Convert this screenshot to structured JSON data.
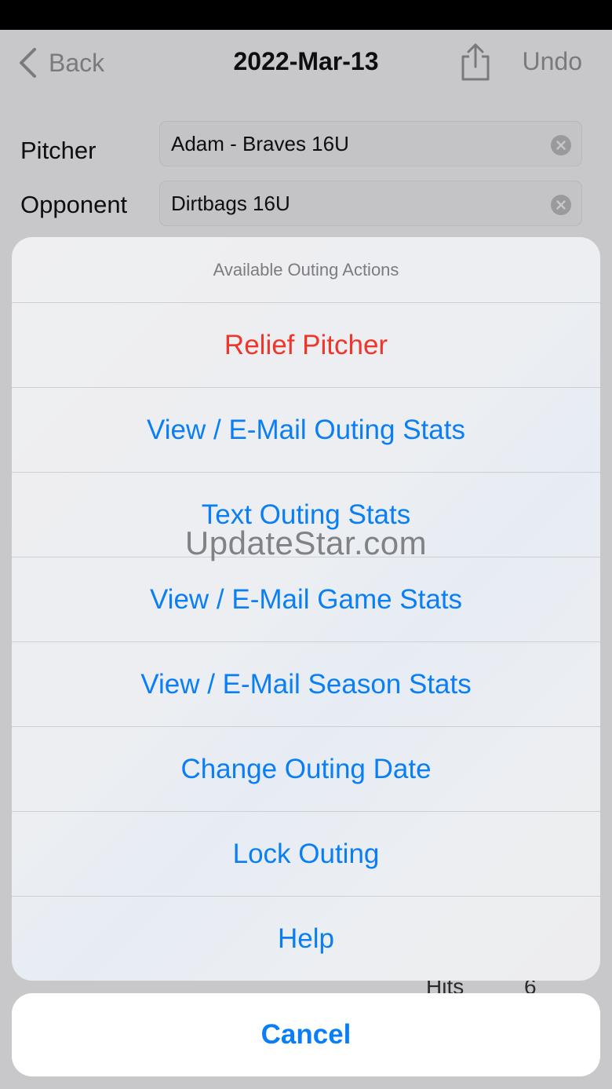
{
  "nav": {
    "back_label": "Back",
    "title": "2022-Mar-13",
    "undo_label": "Undo"
  },
  "form": {
    "pitcher_label": "Pitcher",
    "pitcher_value": "Adam - Braves 16U",
    "opponent_label": "Opponent",
    "opponent_value": "Dirtbags 16U"
  },
  "background": {
    "hits_label": "Hits",
    "hits_value": "6"
  },
  "action_sheet": {
    "title": "Available Outing Actions",
    "actions": [
      "Relief Pitcher",
      "View / E-Mail Outing Stats",
      "Text Outing Stats",
      "View / E-Mail Game Stats",
      "View / E-Mail Season Stats",
      "Change Outing Date",
      "Lock Outing",
      "Help"
    ],
    "cancel_label": "Cancel"
  },
  "watermark": "UpdateStar.com",
  "colors": {
    "accent": "#0a7ff5",
    "destructive": "#f0362b",
    "sheet": "#efeff1",
    "dim_background": "#c8c8ca"
  }
}
